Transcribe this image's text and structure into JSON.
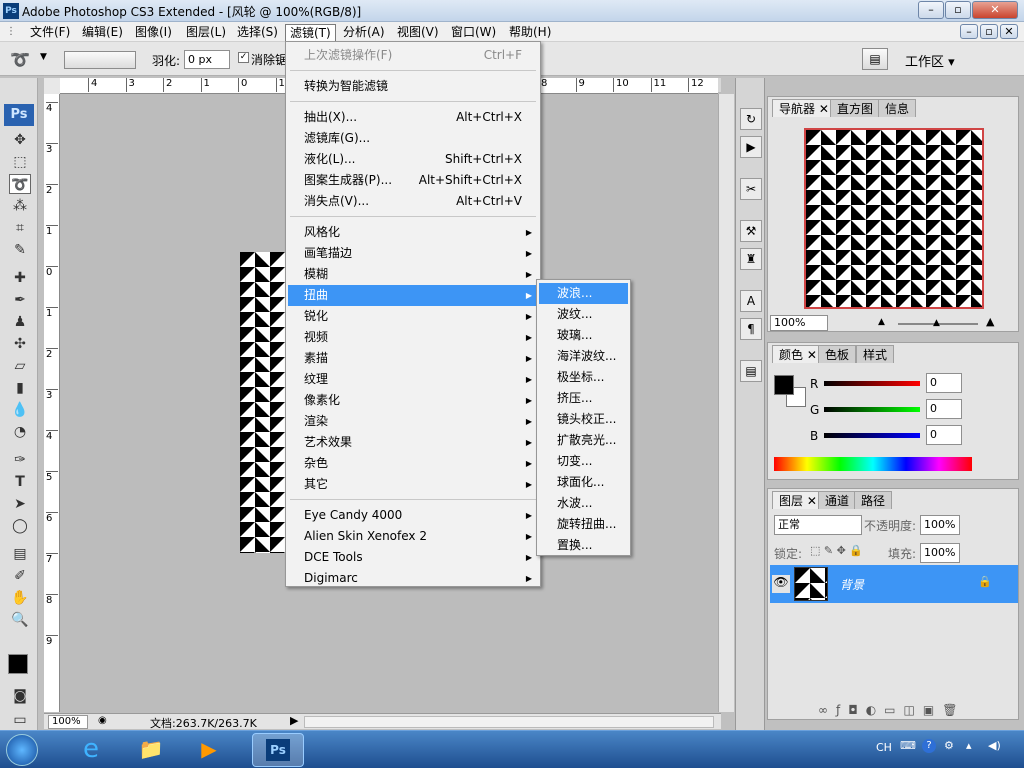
{
  "window": {
    "title": "Adobe Photoshop CS3 Extended - [风轮 @ 100%(RGB/8)]",
    "app_badge": "Ps"
  },
  "menubar": {
    "items": [
      "文件(F)",
      "编辑(E)",
      "图像(I)",
      "图层(L)",
      "选择(S)",
      "滤镜(T)",
      "分析(A)",
      "视图(V)",
      "窗口(W)",
      "帮助(H)"
    ],
    "active": "滤镜(T)"
  },
  "options": {
    "feather_label": "羽化:",
    "feather_value": "0 px",
    "antialias_label": "消除锯",
    "workspace_label": "工作区 ▾"
  },
  "ruler": {
    "h_ticks": [
      "4",
      "3",
      "2",
      "1",
      "0",
      "1",
      "2",
      "3",
      "4",
      "5",
      "6",
      "7",
      "8",
      "9",
      "10",
      "11",
      "12"
    ],
    "v_ticks": [
      "4",
      "3",
      "2",
      "1",
      "0",
      "1",
      "2",
      "3",
      "4",
      "5",
      "6",
      "7",
      "8",
      "9"
    ]
  },
  "filter_menu": {
    "items": [
      {
        "label": "上次滤镜操作(F)",
        "shortcut": "Ctrl+F",
        "disabled": true
      },
      {
        "sep": true
      },
      {
        "label": "转换为智能滤镜"
      },
      {
        "sep": true
      },
      {
        "label": "抽出(X)...",
        "shortcut": "Alt+Ctrl+X"
      },
      {
        "label": "滤镜库(G)..."
      },
      {
        "label": "液化(L)...",
        "shortcut": "Shift+Ctrl+X"
      },
      {
        "label": "图案生成器(P)...",
        "shortcut": "Alt+Shift+Ctrl+X"
      },
      {
        "label": "消失点(V)...",
        "shortcut": "Alt+Ctrl+V"
      },
      {
        "sep": true
      },
      {
        "label": "风格化",
        "submenu": true
      },
      {
        "label": "画笔描边",
        "submenu": true
      },
      {
        "label": "模糊",
        "submenu": true
      },
      {
        "label": "扭曲",
        "submenu": true,
        "highlighted": true
      },
      {
        "label": "锐化",
        "submenu": true
      },
      {
        "label": "视频",
        "submenu": true
      },
      {
        "label": "素描",
        "submenu": true
      },
      {
        "label": "纹理",
        "submenu": true
      },
      {
        "label": "像素化",
        "submenu": true
      },
      {
        "label": "渲染",
        "submenu": true
      },
      {
        "label": "艺术效果",
        "submenu": true
      },
      {
        "label": "杂色",
        "submenu": true
      },
      {
        "label": "其它",
        "submenu": true
      },
      {
        "sep": true
      },
      {
        "label": " Eye Candy 4000",
        "submenu": true
      },
      {
        "label": "Alien Skin Xenofex 2",
        "submenu": true
      },
      {
        "label": "DCE Tools",
        "submenu": true
      },
      {
        "label": "Digimarc",
        "submenu": true
      }
    ]
  },
  "distort_submenu": {
    "items": [
      "波浪...",
      "波纹...",
      "玻璃...",
      "海洋波纹...",
      "极坐标...",
      "挤压...",
      "镜头校正...",
      "扩散亮光...",
      "切变...",
      "球面化...",
      "水波...",
      "旋转扭曲...",
      "置换..."
    ],
    "highlighted_index": 0
  },
  "status": {
    "zoom": "100%",
    "doc_info": "文档:263.7K/263.7K"
  },
  "navigator": {
    "tabs": [
      "导航器",
      "直方图",
      "信息"
    ],
    "zoom": "100%"
  },
  "color_panel": {
    "tabs": [
      "颜色",
      "色板",
      "样式"
    ],
    "r_label": "R",
    "g_label": "G",
    "b_label": "B",
    "r": "0",
    "g": "0",
    "b": "0"
  },
  "layers_panel": {
    "tabs": [
      "图层",
      "通道",
      "路径"
    ],
    "blend_mode": "正常",
    "opacity_label": "不透明度:",
    "opacity": "100%",
    "lock_label": "锁定:",
    "fill_label": "填充:",
    "fill": "100%",
    "layer_name": "背景"
  },
  "taskbar": {
    "tray_lang": "CH"
  },
  "colors": {
    "menu_highlight": "#3d95f5",
    "layer_selected": "#3d95f5",
    "nav_frame": "#d04545"
  }
}
